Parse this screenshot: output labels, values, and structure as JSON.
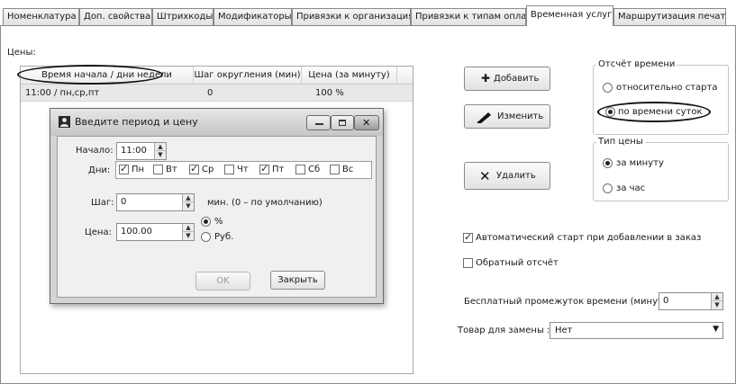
{
  "tabs": [
    {
      "label": "Номенклатура"
    },
    {
      "label": "Доп. свойства"
    },
    {
      "label": "Штрихкоды"
    },
    {
      "label": "Модификаторы"
    },
    {
      "label": "Привязки к организациям"
    },
    {
      "label": "Привязки к типам оплат"
    },
    {
      "label": "Временная услуга"
    },
    {
      "label": "Маршрутизация печати"
    }
  ],
  "active_tab": "Временная услуга",
  "prices_label": "Цены:",
  "grid": {
    "columns": [
      "Время начала / дни недели",
      "Шаг округления (мин)",
      "Цена (за минуту)"
    ],
    "rows": [
      {
        "start": "11:00  /  пн,ср,пт",
        "step": "0",
        "price": "100 %"
      }
    ]
  },
  "dialog": {
    "title": "Введите период и цену",
    "start_label": "Начало:",
    "start_value": "11:00",
    "days_label": "Дни:",
    "days": [
      {
        "label": "Пн",
        "checked": true
      },
      {
        "label": "Вт",
        "checked": false
      },
      {
        "label": "Ср",
        "checked": true
      },
      {
        "label": "Чт",
        "checked": false
      },
      {
        "label": "Пт",
        "checked": true
      },
      {
        "label": "Сб",
        "checked": false
      },
      {
        "label": "Вс",
        "checked": false
      }
    ],
    "step_label": "Шаг:",
    "step_value": "0",
    "step_hint": "мин. (0 – по умолчанию)",
    "price_label": "Цена:",
    "price_value": "100.00",
    "unit_percent": "%",
    "unit_rub": "Руб.",
    "unit_selected": "%",
    "ok_label": "OK",
    "close_label": "Закрыть"
  },
  "actions": {
    "add_label": "Добавить",
    "edit_label": "Изменить",
    "delete_label": "Удалить"
  },
  "time_reference": {
    "legend": "Отсчёт времени",
    "options": [
      "относительно старта",
      "по времени суток"
    ],
    "selected": "по времени суток"
  },
  "price_type": {
    "legend": "Тип цены",
    "options": [
      "за минуту",
      "за час"
    ],
    "selected": "за минуту"
  },
  "auto_start": {
    "label": "Автоматический старт при добавлении в заказ",
    "checked": true
  },
  "countdown": {
    "label": "Обратный отсчёт",
    "checked": false
  },
  "free_interval": {
    "label": "Бесплатный промежуток времени (минут) :",
    "value": "0"
  },
  "replacement": {
    "label": "Товар для замены :",
    "value": "Нет"
  }
}
